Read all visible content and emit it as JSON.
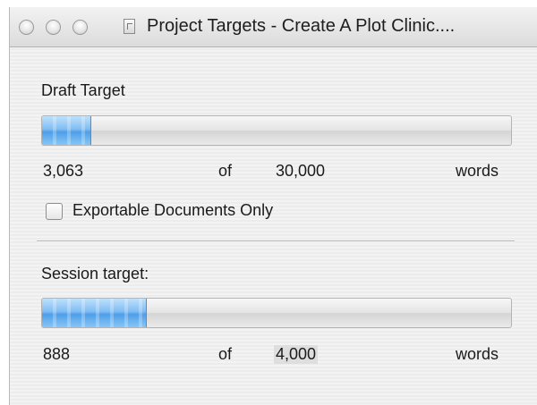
{
  "window": {
    "title": "Project Targets - Create A Plot Clinic...."
  },
  "draft": {
    "label": "Draft Target",
    "progress_fraction": 0.1021,
    "current": "3,063",
    "of_label": "of",
    "target": "30,000",
    "unit": "words",
    "checkbox_label": "Exportable Documents Only",
    "checkbox_checked": false
  },
  "session": {
    "label": "Session target:",
    "progress_fraction": 0.222,
    "current": "888",
    "of_label": "of",
    "target": "4,000",
    "unit": "words"
  },
  "colors": {
    "progress_fill": "#6fb3ef",
    "window_bg": "#f0f0f0"
  },
  "icons": {
    "close": "close-traffic-light",
    "minimize": "minimize-traffic-light",
    "zoom": "zoom-traffic-light",
    "document": "document-proxy-icon"
  }
}
